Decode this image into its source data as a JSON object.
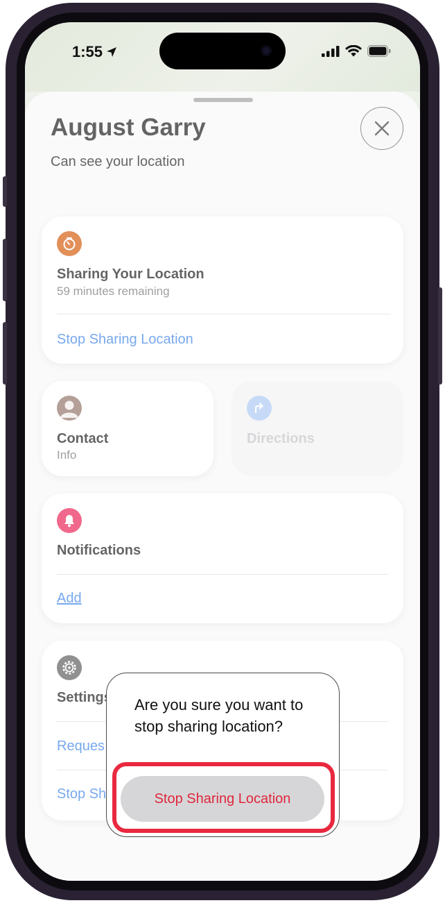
{
  "status_bar": {
    "time": "1:55"
  },
  "sheet": {
    "title": "August Garry",
    "subtitle": "Can see your location"
  },
  "sharing_card": {
    "title": "Sharing Your Location",
    "remaining": "59 minutes remaining",
    "stop_link": "Stop Sharing Location",
    "icon_color": "#d35400"
  },
  "contact_card": {
    "title": "Contact",
    "sub": "Info",
    "icon_color": "#8d6e63"
  },
  "directions_card": {
    "title": "Directions",
    "icon_color": "#a8c7f5",
    "disabled": true
  },
  "notifications_card": {
    "title": "Notifications",
    "add_link": "Add",
    "icon_color": "#e8194f"
  },
  "settings_card": {
    "title": "Settings",
    "row1_link": "Reques",
    "row2_link": "Stop Sh",
    "icon_color": "#555555"
  },
  "confirm_popover": {
    "message": "Are you sure you want to stop sharing location?",
    "confirm_button": "Stop Sharing Location",
    "confirm_color": "#e0263c",
    "highlight_color": "#e8293f"
  }
}
